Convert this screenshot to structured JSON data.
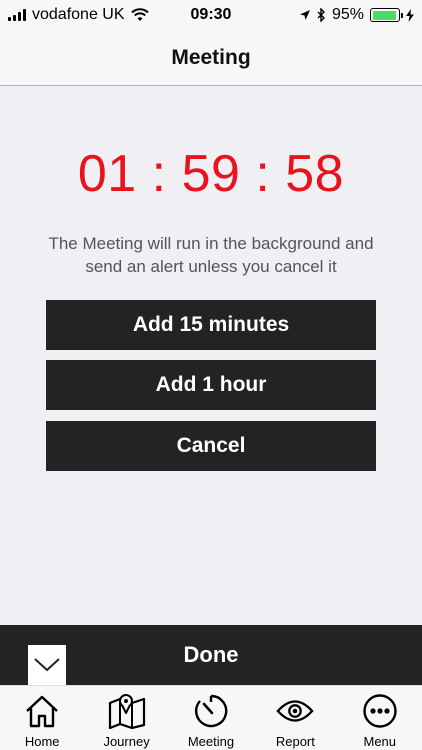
{
  "status_bar": {
    "carrier": "vodafone UK",
    "time": "09:30",
    "battery_percent": "95%",
    "battery_level": 0.95,
    "battery_color": "#4cd964",
    "icons": [
      "signal-icon",
      "wifi-icon",
      "location-icon",
      "bluetooth-icon",
      "battery-icon",
      "charging-icon"
    ]
  },
  "nav": {
    "title": "Meeting"
  },
  "timer": {
    "display": "01 : 59 : 58",
    "color": "#e8131d"
  },
  "message": {
    "line1": "The Meeting will run in the background and",
    "line2": "send an alert unless you cancel it"
  },
  "actions": {
    "add15": "Add 15 minutes",
    "add1h": "Add 1 hour",
    "cancel": "Cancel"
  },
  "done_bar": {
    "label": "Done",
    "collapse_icon": "chevron-down-icon"
  },
  "tab_bar": {
    "items": [
      {
        "label": "Home",
        "icon": "home-icon"
      },
      {
        "label": "Journey",
        "icon": "map-icon"
      },
      {
        "label": "Meeting",
        "icon": "timer-icon"
      },
      {
        "label": "Report",
        "icon": "eye-icon"
      },
      {
        "label": "Menu",
        "icon": "more-icon"
      }
    ]
  }
}
